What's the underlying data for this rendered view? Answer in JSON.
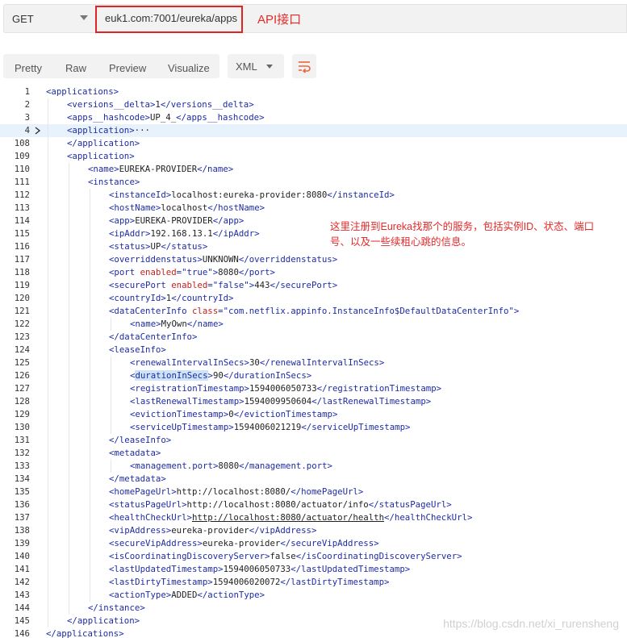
{
  "request": {
    "method": "GET",
    "url": "euk1.com:7001/eureka/apps",
    "note": "API接口"
  },
  "toolbar": {
    "tabs": [
      "Pretty",
      "Raw",
      "Preview",
      "Visualize"
    ],
    "format": "XML",
    "wrap_icon": "wrap-lines-icon"
  },
  "annotation": "这里注册到Eureka找那个的服务，包括实例ID、状态、端口号、以及一些续租心跳的信息。",
  "watermark": "https://blog.csdn.net/xi_rurensheng",
  "colors": {
    "tag": "#1d2ba8",
    "attr": "#c81e1e",
    "note": "#e52a2a",
    "highlight_box": "#e02424"
  },
  "code_lines": [
    {
      "n": "1",
      "indent": 0,
      "html": "<span class='tag'>&lt;applications&gt;</span>"
    },
    {
      "n": "2",
      "indent": 1,
      "html": "<span class='tag'>&lt;versions__delta&gt;</span><span class='val'>1</span><span class='tag'>&lt;/versions__delta&gt;</span>"
    },
    {
      "n": "3",
      "indent": 1,
      "html": "<span class='tag'>&lt;apps__hashcode&gt;</span><span class='val'>UP_4_</span><span class='tag'>&lt;/apps__hashcode&gt;</span>"
    },
    {
      "n": "4",
      "indent": 1,
      "html": "<span class='tag'>&lt;application&gt;</span><span class='val'>···</span>",
      "fold": true,
      "hl": true
    },
    {
      "n": "108",
      "indent": 1,
      "html": "<span class='tag'>&lt;/application&gt;</span>"
    },
    {
      "n": "109",
      "indent": 1,
      "html": "<span class='tag'>&lt;application&gt;</span>"
    },
    {
      "n": "110",
      "indent": 2,
      "html": "<span class='tag'>&lt;name&gt;</span><span class='val'>EUREKA-PROVIDER</span><span class='tag'>&lt;/name&gt;</span>"
    },
    {
      "n": "111",
      "indent": 2,
      "html": "<span class='tag'>&lt;instance&gt;</span>"
    },
    {
      "n": "112",
      "indent": 3,
      "html": "<span class='tag'>&lt;instanceId&gt;</span><span class='val'>localhost:eureka-provider:8080</span><span class='tag'>&lt;/instanceId&gt;</span>"
    },
    {
      "n": "113",
      "indent": 3,
      "html": "<span class='tag'>&lt;hostName&gt;</span><span class='val'>localhost</span><span class='tag'>&lt;/hostName&gt;</span>"
    },
    {
      "n": "114",
      "indent": 3,
      "html": "<span class='tag'>&lt;app&gt;</span><span class='val'>EUREKA-PROVIDER</span><span class='tag'>&lt;/app&gt;</span>"
    },
    {
      "n": "115",
      "indent": 3,
      "html": "<span class='tag'>&lt;ipAddr&gt;</span><span class='val'>192.168.13.1</span><span class='tag'>&lt;/ipAddr&gt;</span>"
    },
    {
      "n": "116",
      "indent": 3,
      "html": "<span class='tag'>&lt;status&gt;</span><span class='val'>UP</span><span class='tag'>&lt;/status&gt;</span>"
    },
    {
      "n": "117",
      "indent": 3,
      "html": "<span class='tag'>&lt;overriddenstatus&gt;</span><span class='val'>UNKNOWN</span><span class='tag'>&lt;/overriddenstatus&gt;</span>"
    },
    {
      "n": "118",
      "indent": 3,
      "html": "<span class='tag'>&lt;port </span><span class='attr'>enabled</span><span class='tag'>=</span><span class='str'>\"true\"</span><span class='tag'>&gt;</span><span class='val'>8080</span><span class='tag'>&lt;/port&gt;</span>"
    },
    {
      "n": "119",
      "indent": 3,
      "html": "<span class='tag'>&lt;securePort </span><span class='attr'>enabled</span><span class='tag'>=</span><span class='str'>\"false\"</span><span class='tag'>&gt;</span><span class='val'>443</span><span class='tag'>&lt;/securePort&gt;</span>"
    },
    {
      "n": "120",
      "indent": 3,
      "html": "<span class='tag'>&lt;countryId&gt;</span><span class='val'>1</span><span class='tag'>&lt;/countryId&gt;</span>"
    },
    {
      "n": "121",
      "indent": 3,
      "html": "<span class='tag'>&lt;dataCenterInfo </span><span class='attr'>class</span><span class='tag'>=</span><span class='str'>\"com.netflix.appinfo.InstanceInfo$DefaultDataCenterInfo\"</span><span class='tag'>&gt;</span>"
    },
    {
      "n": "122",
      "indent": 4,
      "html": "<span class='tag'>&lt;name&gt;</span><span class='val'>MyOwn</span><span class='tag'>&lt;/name&gt;</span>"
    },
    {
      "n": "123",
      "indent": 3,
      "html": "<span class='tag'>&lt;/dataCenterInfo&gt;</span>"
    },
    {
      "n": "124",
      "indent": 3,
      "html": "<span class='tag'>&lt;leaseInfo&gt;</span>"
    },
    {
      "n": "125",
      "indent": 4,
      "html": "<span class='tag'>&lt;renewalIntervalInSecs&gt;</span><span class='val'>30</span><span class='tag'>&lt;/renewalIntervalInSecs&gt;</span>"
    },
    {
      "n": "126",
      "indent": 4,
      "html": "<span class='tag'>&lt;<span class='sel'>durationInSecs</span>&gt;</span><span class='val'>90</span><span class='tag'>&lt;/durationInSecs&gt;</span>"
    },
    {
      "n": "127",
      "indent": 4,
      "html": "<span class='tag'>&lt;registrationTimestamp&gt;</span><span class='val'>1594006050733</span><span class='tag'>&lt;/registrationTimestamp&gt;</span>"
    },
    {
      "n": "128",
      "indent": 4,
      "html": "<span class='tag'>&lt;lastRenewalTimestamp&gt;</span><span class='val'>1594009950604</span><span class='tag'>&lt;/lastRenewalTimestamp&gt;</span>"
    },
    {
      "n": "129",
      "indent": 4,
      "html": "<span class='tag'>&lt;evictionTimestamp&gt;</span><span class='val'>0</span><span class='tag'>&lt;/evictionTimestamp&gt;</span>"
    },
    {
      "n": "130",
      "indent": 4,
      "html": "<span class='tag'>&lt;serviceUpTimestamp&gt;</span><span class='val'>1594006021219</span><span class='tag'>&lt;/serviceUpTimestamp&gt;</span>"
    },
    {
      "n": "131",
      "indent": 3,
      "html": "<span class='tag'>&lt;/leaseInfo&gt;</span>"
    },
    {
      "n": "132",
      "indent": 3,
      "html": "<span class='tag'>&lt;metadata&gt;</span>"
    },
    {
      "n": "133",
      "indent": 4,
      "html": "<span class='tag'>&lt;management.port&gt;</span><span class='val'>8080</span><span class='tag'>&lt;/management.port&gt;</span>"
    },
    {
      "n": "134",
      "indent": 3,
      "html": "<span class='tag'>&lt;/metadata&gt;</span>"
    },
    {
      "n": "135",
      "indent": 3,
      "html": "<span class='tag'>&lt;homePageUrl&gt;</span><span class='val'>http://localhost:8080/</span><span class='tag'>&lt;/homePageUrl&gt;</span>"
    },
    {
      "n": "136",
      "indent": 3,
      "html": "<span class='tag'>&lt;statusPageUrl&gt;</span><span class='val'>http://localhost:8080/actuator/info</span><span class='tag'>&lt;/statusPageUrl&gt;</span>"
    },
    {
      "n": "137",
      "indent": 3,
      "html": "<span class='tag'>&lt;healthCheckUrl&gt;</span><span class='val' style='text-decoration:underline'>http://localhost:8080/actuator/health</span><span class='tag'>&lt;/healthCheckUrl&gt;</span>"
    },
    {
      "n": "138",
      "indent": 3,
      "html": "<span class='tag'>&lt;vipAddress&gt;</span><span class='val'>eureka-provider</span><span class='tag'>&lt;/vipAddress&gt;</span>"
    },
    {
      "n": "139",
      "indent": 3,
      "html": "<span class='tag'>&lt;secureVipAddress&gt;</span><span class='val'>eureka-provider</span><span class='tag'>&lt;/secureVipAddress&gt;</span>"
    },
    {
      "n": "140",
      "indent": 3,
      "html": "<span class='tag'>&lt;isCoordinatingDiscoveryServer&gt;</span><span class='val'>false</span><span class='tag'>&lt;/isCoordinatingDiscoveryServer&gt;</span>"
    },
    {
      "n": "141",
      "indent": 3,
      "html": "<span class='tag'>&lt;lastUpdatedTimestamp&gt;</span><span class='val'>1594006050733</span><span class='tag'>&lt;/lastUpdatedTimestamp&gt;</span>"
    },
    {
      "n": "142",
      "indent": 3,
      "html": "<span class='tag'>&lt;lastDirtyTimestamp&gt;</span><span class='val'>1594006020072</span><span class='tag'>&lt;/lastDirtyTimestamp&gt;</span>"
    },
    {
      "n": "143",
      "indent": 3,
      "html": "<span class='tag'>&lt;actionType&gt;</span><span class='val'>ADDED</span><span class='tag'>&lt;/actionType&gt;</span>"
    },
    {
      "n": "144",
      "indent": 2,
      "html": "<span class='tag'>&lt;/instance&gt;</span>"
    },
    {
      "n": "145",
      "indent": 1,
      "html": "<span class='tag'>&lt;/application&gt;</span>"
    },
    {
      "n": "146",
      "indent": 0,
      "html": "<span class='tag'>&lt;/applications&gt;</span>"
    }
  ]
}
